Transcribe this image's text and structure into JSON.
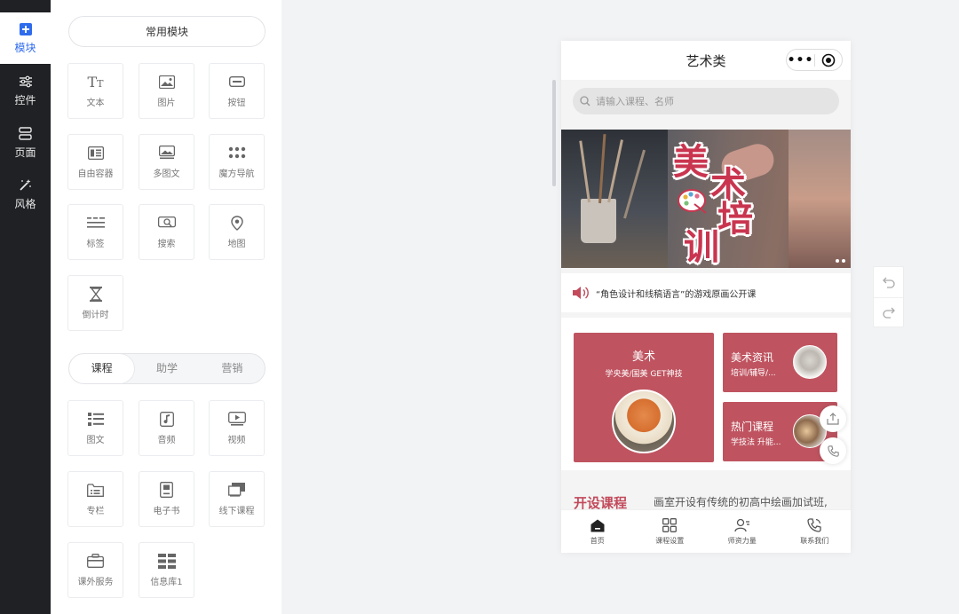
{
  "rail": {
    "items": [
      {
        "label": "模块",
        "icon": "plus-square-icon",
        "active": true
      },
      {
        "label": "控件",
        "icon": "sliders-icon"
      },
      {
        "label": "页面",
        "icon": "pages-icon"
      },
      {
        "label": "风格",
        "icon": "magic-wand-icon"
      }
    ]
  },
  "panel": {
    "common_title": "常用模块",
    "common_modules": [
      "文本",
      "图片",
      "按钮",
      "自由容器",
      "多图文",
      "魔方导航",
      "标签",
      "搜索",
      "地图",
      "倒计时"
    ],
    "segment_tabs": [
      "课程",
      "助学",
      "营销"
    ],
    "segment_active": "课程",
    "course_modules": [
      "图文",
      "音频",
      "视频",
      "专栏",
      "电子书",
      "线下课程",
      "课外服务",
      "信息库1"
    ]
  },
  "phone": {
    "title": "艺术类",
    "capsule_dots": "•••",
    "search_placeholder": "请输入课程、名师",
    "banner_chars": [
      "美",
      "术",
      "培",
      "训"
    ],
    "notice_text": "“角色设计和线稿语言”的游戏原画公开课",
    "card_big": {
      "title": "美术",
      "subtitle": "学央美/国美 GET神技"
    },
    "card_small_1": {
      "title": "美术资讯",
      "subtitle": "培训/辅导/..."
    },
    "card_small_2": {
      "title": "热门课程",
      "subtitle": "学技法 升能..."
    },
    "section_heading": "开设课程",
    "section_desc": "画室开设有传统的初高中绘画加试班,",
    "tabbar": [
      "首页",
      "课程设置",
      "师资力量",
      "联系我们"
    ]
  },
  "colors": {
    "accent": "#2f6bed",
    "card": "#bf5460",
    "heading": "#c24a5b",
    "rail": "#1f2124"
  }
}
